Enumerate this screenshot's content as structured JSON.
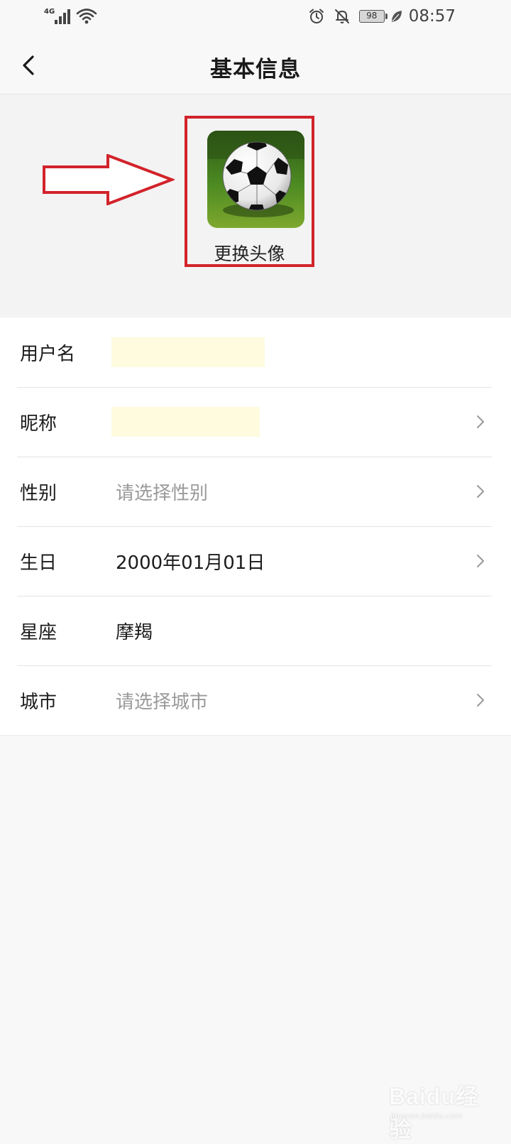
{
  "status_bar": {
    "network_type": "4G",
    "battery_level": "98",
    "time": "08:57"
  },
  "header": {
    "title": "基本信息"
  },
  "avatar_section": {
    "change_avatar_label": "更换头像",
    "highlight_color": "#d2232a"
  },
  "info_list": {
    "rows": [
      {
        "label": "用户名",
        "value": "",
        "has_chevron": false
      },
      {
        "label": "昵称",
        "value": "",
        "has_chevron": true
      },
      {
        "label": "性别",
        "value": "请选择性别",
        "placeholder": true,
        "has_chevron": true
      },
      {
        "label": "生日",
        "value": "2000年01月01日",
        "has_chevron": true
      },
      {
        "label": "星座",
        "value": "摩羯",
        "has_chevron": false
      },
      {
        "label": "城市",
        "value": "请选择城市",
        "placeholder": true,
        "has_chevron": true
      }
    ]
  },
  "watermark": {
    "brand": "Baidu经验",
    "url": "jingyan.baidu.com"
  },
  "icons": {
    "back": "chevron-left-icon",
    "chevron": "chevron-right-icon",
    "alarm": "alarm-clock-icon",
    "mute": "bell-off-icon",
    "eco": "leaf-icon",
    "wifi": "wifi-icon",
    "signal": "signal-icon",
    "avatar": "soccer-ball-image"
  },
  "colors": {
    "background": "#f8f8f8",
    "list_background": "#ffffff",
    "placeholder_text": "#9a9a9a",
    "annotation_red": "#d2232a",
    "redaction_fill": "#fefbdf"
  }
}
